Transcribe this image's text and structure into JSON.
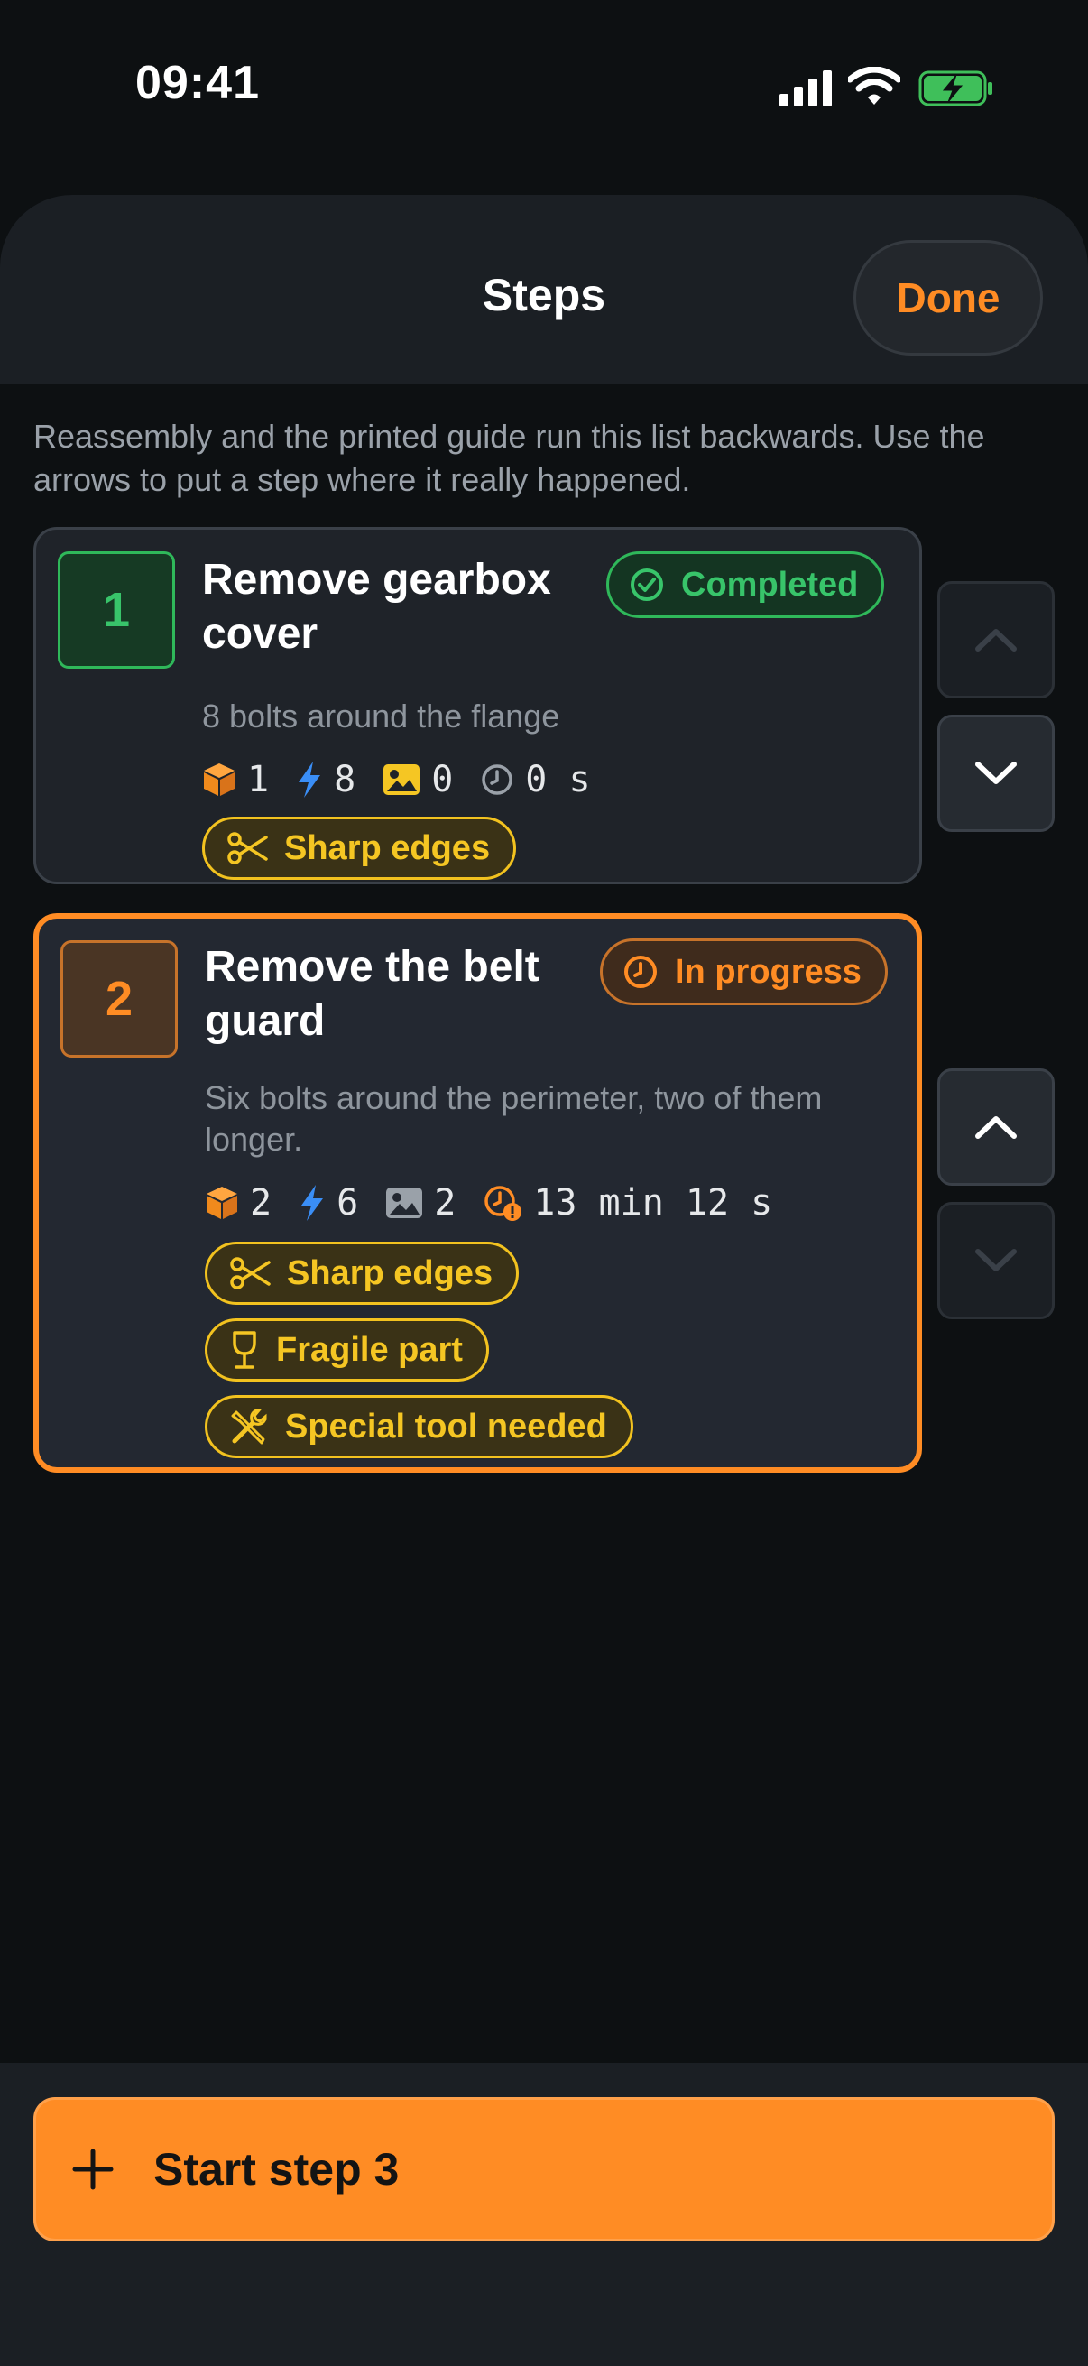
{
  "status_bar": {
    "time": "09:41"
  },
  "header": {
    "title": "Steps",
    "done_label": "Done"
  },
  "intro": "Reassembly and the printed guide run this list backwards. Use the arrows to put a step where it really happened.",
  "steps": [
    {
      "number": "1",
      "title": "Remove gearbox cover",
      "status": "Completed",
      "description": "8 bolts around the flange",
      "parts": "1",
      "bolts": "8",
      "photos": "0",
      "duration": "0 s",
      "tags": [
        "Sharp edges"
      ]
    },
    {
      "number": "2",
      "title": "Remove the belt guard",
      "status": "In progress",
      "description": "Six bolts around the perimeter, two of them longer.",
      "parts": "2",
      "bolts": "6",
      "photos": "2",
      "duration": "13 min 12 s",
      "tags": [
        "Sharp edges",
        "Fragile part",
        "Special tool needed"
      ]
    }
  ],
  "footer": {
    "start_label": "Start step 3"
  },
  "colors": {
    "accent": "#ff8c24",
    "completed": "#38c46a",
    "warning_tag": "#f5c623",
    "background": "#0d1012",
    "card": "#1f2329"
  }
}
